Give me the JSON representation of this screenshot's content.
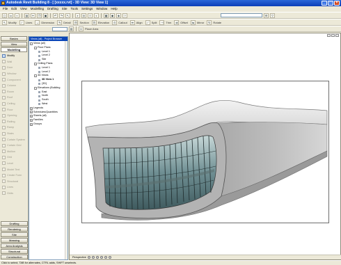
{
  "window": {
    "title": "Autodesk Revit Building 8 - [ [xxxxx.rvt] - 3D View: 3D View 1]"
  },
  "menu": [
    "File",
    "Edit",
    "View",
    "Modelling",
    "Drafting",
    "Site",
    "Tools",
    "Settings",
    "Window",
    "Help"
  ],
  "toolbar": {
    "row2_items": [
      "Modify",
      "Lines",
      "Dimension",
      "Detail",
      "Section",
      "Elevation",
      "Callout",
      "Align",
      "Split",
      "Trim",
      "Offset",
      "Mirror",
      "Rotate"
    ],
    "row3_items": [
      "Place Area"
    ]
  },
  "design_bar": {
    "top_tabs": [
      "Basics",
      "View",
      "Modelling"
    ],
    "active_tab": "Modelling",
    "tools": [
      "Modify",
      "Wall",
      "Door",
      "Window",
      "Component",
      "Column",
      "Room",
      "Roof",
      "Ceiling",
      "Floor",
      "Opening",
      "Railing",
      "Ramp",
      "Stairs",
      "Curtain System",
      "Curtain Grid",
      "Mullion",
      "Grid",
      "Level",
      "Model Text",
      "Create Form",
      "Structural",
      "Lines",
      "Grids"
    ],
    "bottom_tabs": [
      "Drafting",
      "Rendering",
      "Site",
      "Massing",
      "Area Analysis",
      "Structural",
      "Construction"
    ]
  },
  "project_browser": {
    "title": "Views (all) - Project Browser",
    "items": [
      {
        "label": "Views (all)",
        "level": 0,
        "exp": "-"
      },
      {
        "label": "Floor Plans",
        "level": 1,
        "exp": "-"
      },
      {
        "label": "Level 1",
        "level": 2
      },
      {
        "label": "Level 2",
        "level": 2
      },
      {
        "label": "Site",
        "level": 2
      },
      {
        "label": "Ceiling Plans",
        "level": 1,
        "exp": "-"
      },
      {
        "label": "Level 1",
        "level": 2
      },
      {
        "label": "Level 2",
        "level": 2
      },
      {
        "label": "3D Views",
        "level": 1,
        "exp": "-"
      },
      {
        "label": "3D View 1",
        "level": 2,
        "bold": true
      },
      {
        "label": "{3D}",
        "level": 2
      },
      {
        "label": "Elevations (Building",
        "level": 1,
        "exp": "-"
      },
      {
        "label": "East",
        "level": 2
      },
      {
        "label": "North",
        "level": 2
      },
      {
        "label": "South",
        "level": 2
      },
      {
        "label": "West",
        "level": 2
      },
      {
        "label": "Legends",
        "level": 0,
        "exp": "+"
      },
      {
        "label": "Schedules/Quantities",
        "level": 0,
        "exp": "+"
      },
      {
        "label": "Sheets (all)",
        "level": 0,
        "exp": "+"
      },
      {
        "label": "Families",
        "level": 0,
        "exp": "+"
      },
      {
        "label": "Groups",
        "level": 0,
        "exp": "+"
      }
    ]
  },
  "view": {
    "detail_level": "Perspective"
  },
  "status": {
    "text": "Click to select, TAB for alternates, CTRL adds, SHIFT unselects."
  }
}
